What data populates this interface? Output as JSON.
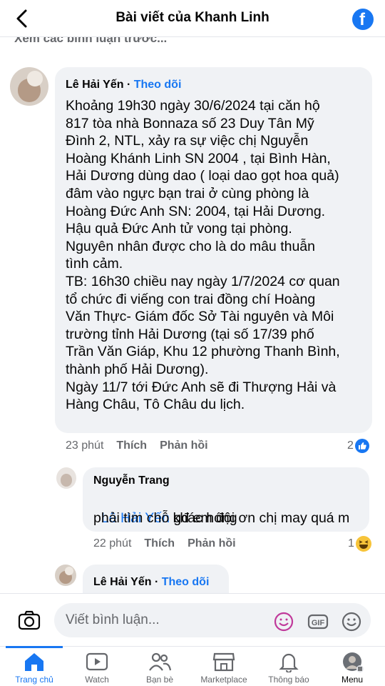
{
  "header": {
    "title": "Bài viết của Khanh Linh"
  },
  "prev_comments_label": "Xem các bình luận trước...",
  "comments": [
    {
      "author": "Lê Hải Yến",
      "separator": " · ",
      "follow": "Theo dõi",
      "body": "Khoảng 19h30 ngày 30/6/2024 tại căn hộ\n817 tòa nhà Bonnaza số 23 Duy Tân Mỹ\nĐình 2, NTL, xảy ra sự việc chị Nguyễn\nHoàng Khánh Linh SN 2004 , tại Bình Hàn,\nHải Dương dùng dao ( loại dao gọt hoa quả)\nđâm vào ngực bạn trai ở cùng phòng là\nHoàng Đức Anh SN: 2004, tại Hải Dương.\nHậu quả Đức Anh tử vong tại phòng.\nNguyên nhân được cho là do mâu thuẫn\ntình cảm.\nTB: 16h30 chiều nay ngày 1/7/2024 cơ quan\ntổ chức đi viếng con trai đồng chí Hoàng\nVăn Thực- Giám đốc Sở Tài nguyên và Môi\ntrường tỉnh Hải Dương (tại số 17/39 phố\nTrần Văn Giáp, Khu 12 phường Thanh Bình,\nthành phố Hải Dương).\nNgày 11/7 tới Đức Anh sẽ đi Thượng Hải và\nHàng Châu, Tô Châu du lịch.",
      "time": "23 phút",
      "like": "Thích",
      "reply": "Phản hồi",
      "reaction_count": "2",
      "reaction_icon": "like-reaction-icon"
    },
    {
      "author": "Nguyễn Trang",
      "mention": "Lê Hải Yến",
      "body_line1": " gđ em đội ơn chị may quá m",
      "body_line2": "phải tìm chỗ khác hóng",
      "time": "22 phút",
      "like": "Thích",
      "reply": "Phản hồi",
      "reaction_count": "1",
      "reaction_icon": "haha-reaction-icon"
    },
    {
      "author": "Lê Hải Yến",
      "separator": " · ",
      "follow": "Theo dõi"
    }
  ],
  "composer": {
    "placeholder": "Viết bình luận..."
  },
  "tabs": [
    {
      "label": "Trang chủ",
      "icon": "home-icon"
    },
    {
      "label": "Watch",
      "icon": "watch-icon"
    },
    {
      "label": "Bạn bè",
      "icon": "friends-icon"
    },
    {
      "label": "Marketplace",
      "icon": "marketplace-icon"
    },
    {
      "label": "Thông báo",
      "icon": "bell-icon"
    },
    {
      "label": "Menu",
      "icon": "menu-avatar-icon"
    }
  ],
  "colors": {
    "accent": "#1877f2",
    "bubble": "#f0f2f5",
    "secondary_text": "#65676b"
  }
}
